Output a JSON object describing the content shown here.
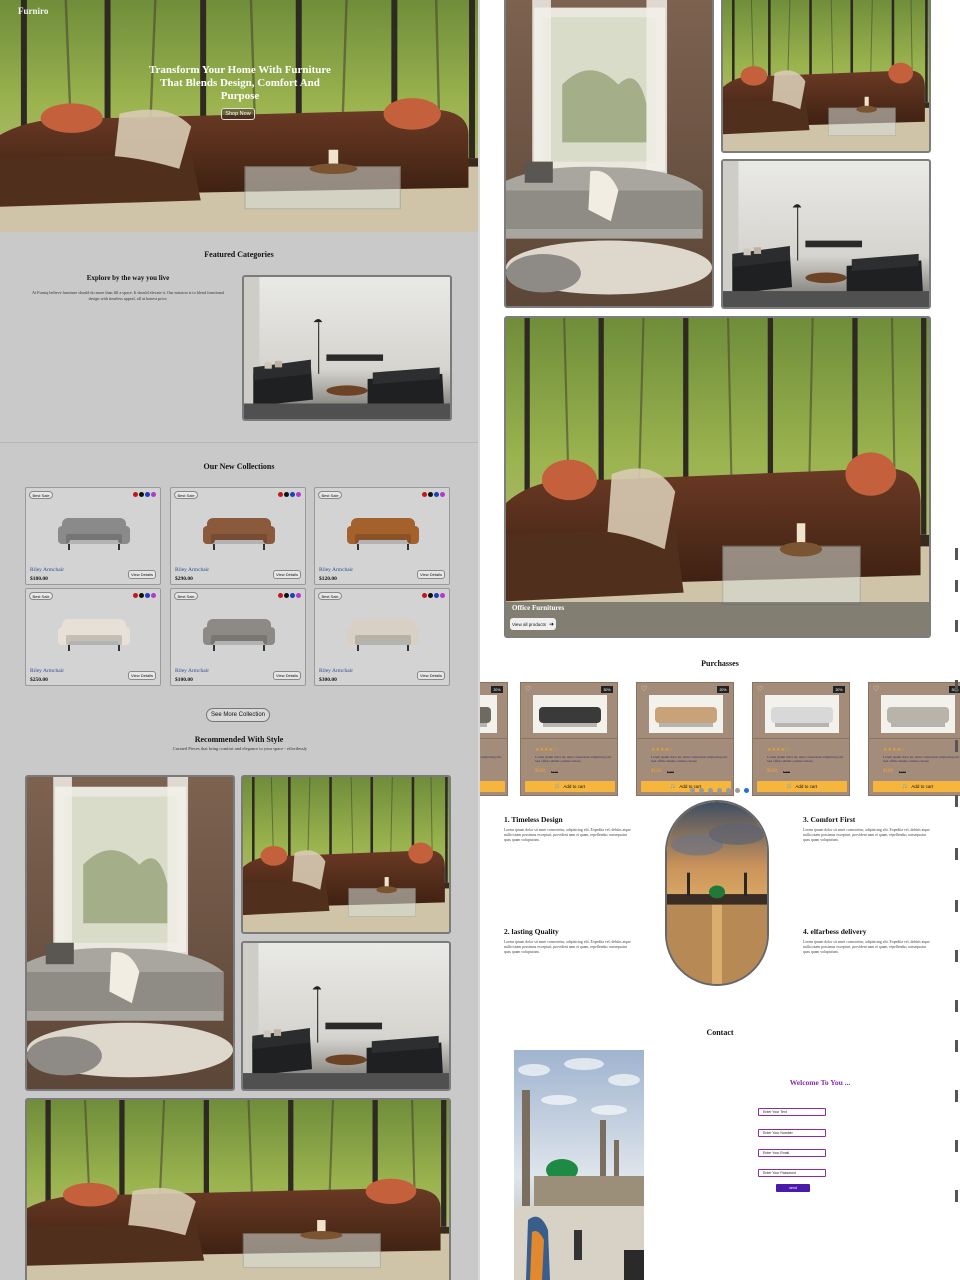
{
  "header": {
    "logo": "Furniro"
  },
  "hero": {
    "title": "Transform Your Home With Furniture That Blends Design, Comfort And Purpose",
    "subtitle": "",
    "button": "Shop Now"
  },
  "featured": {
    "title": "Featured Categories",
    "explore_title": "Explore by the way you live",
    "explore_text": "At Furniq believe furniture should do more than fill a space. It should elevate it. Our mission is to blend functional design with timeless appeal, all at honest price."
  },
  "collections": {
    "title": "Our New Collections",
    "badge": "Best Sale",
    "view_label": "View Details",
    "swatch_colors": [
      "#c21818",
      "#111111",
      "#1d3fb8",
      "#b03bc8",
      "#d6c21a"
    ],
    "items": [
      {
        "name": "Riley Armchair",
        "price": "$180.00"
      },
      {
        "name": "Riley Armchair",
        "price": "$290.00"
      },
      {
        "name": "Riley Armchair",
        "price": "$120.00"
      },
      {
        "name": "Riley Armchair",
        "price": "$250.00"
      },
      {
        "name": "Riley Armchair",
        "price": "$100.00"
      },
      {
        "name": "Riley Armchair",
        "price": "$300.00"
      }
    ],
    "see_more": "See More Collection"
  },
  "recommended": {
    "title": "Recommended With Style",
    "subtitle": "Curated Pieces that bring comfort and elegance to your space - effortlessly"
  },
  "office": {
    "label": "Office Furnitures",
    "button": "View all products"
  },
  "purchases": {
    "title": "Purchasses",
    "cart_label": "Add to cart",
    "stars": "★★★★☆",
    "items": [
      {
        "discount": "20%",
        "desc": "Lorem ipsum dolor sit, amet consectetur adipisicing elit. Sed officia ullamco minus ratione",
        "price": "$100",
        "old": "$200"
      },
      {
        "discount": "30%",
        "desc": "Lorem ipsum dolor sit, amet consectetur adipisicing elit. Sed officia ullamco minus ratione",
        "price": "$100",
        "old": "$150"
      },
      {
        "discount": "20%",
        "desc": "Lorem ipsum dolor sit, amet consectetur adipisicing elit. Sed officia ullamco minus ratione",
        "price": "$120",
        "old": "$200"
      }
    ]
  },
  "features": [
    {
      "title": "1. Timeless Design",
      "text": "Lorem ipsum dolor sit amet consectetur, adipisicing elit. Expedita vel, debitis atque nulla totam possimus excepturi, provident nam et quam, repellendus consequatur quas quam voluptatum."
    },
    {
      "title": "3. Comfort First",
      "text": "Lorem ipsum dolor sit amet consectetur, adipisicing elit. Expedita vel, debitis atque nulla totam possimus excepturi, provident nam et quam, repellendus consequatur quas quam voluptatum."
    },
    {
      "title": "2. lasting Quality",
      "text": "Lorem ipsum dolor sit amet consectetur, adipisicing elit. Expedita vel, debitis atque nulla totam possimus excepturi, provident nam et quam, repellendus consequatur quas quam voluptatum."
    },
    {
      "title": "4. elfarbess delivery",
      "text": "Lorem ipsum dolor sit amet consectetur, adipisicing elit. Expedita vel, debitis atque nulla totam possimus excepturi, provident nam et quam, repellendus consequatur quas quam voluptatum."
    }
  ],
  "contact": {
    "title": "Contact",
    "welcome": "Welcome To You ...",
    "fields": [
      {
        "placeholder": "Enter Your Text"
      },
      {
        "placeholder": "Enter Your Number"
      },
      {
        "placeholder": "Enter Your Email"
      },
      {
        "placeholder": "Enter Your Password"
      }
    ],
    "send": "send"
  },
  "icons": {
    "arrow": "arrow-right-icon",
    "cart": "cart-icon",
    "heart": "heart-icon"
  },
  "colors": {
    "page_left": "#c9c9c9",
    "accent_orange": "#f6b63e",
    "card_brown": "#a38c79",
    "form_purple": "#8a2ab0",
    "send_purple": "#4a1aa8"
  }
}
